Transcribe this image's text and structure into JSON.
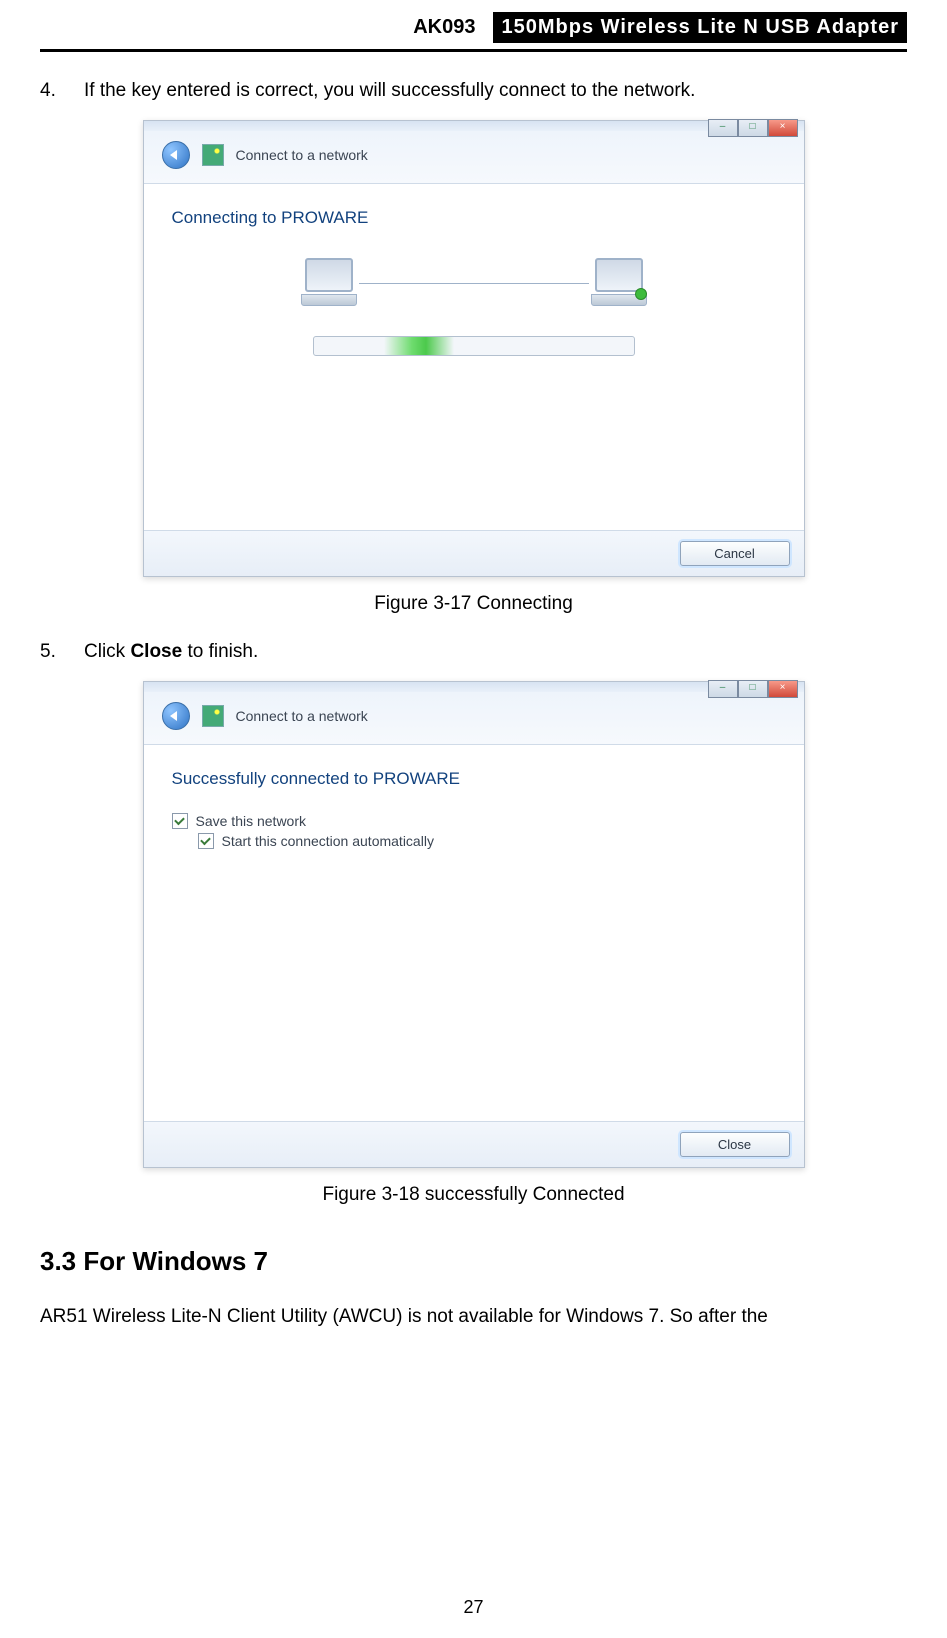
{
  "header": {
    "model": "AK093",
    "product": "150Mbps Wireless Lite N USB Adapter"
  },
  "steps": {
    "s4_num": "4.",
    "s4_text": "If the key entered is correct, you will successfully connect to the network.",
    "s5_num": "5.",
    "s5_pre": "Click ",
    "s5_bold": "Close",
    "s5_post": " to finish."
  },
  "dialog1": {
    "toolbar": "Connect to a network",
    "title": "Connecting to PROWARE",
    "cancel": "Cancel"
  },
  "dialog2": {
    "toolbar": "Connect to a network",
    "title": "Successfully connected to PROWARE",
    "chk1": "Save this network",
    "chk2": "Start this connection automatically",
    "close": "Close"
  },
  "captions": {
    "c1": "Figure 3-17 Connecting",
    "c2": "Figure 3-18 successfully Connected"
  },
  "section": {
    "heading": "3.3    For Windows 7",
    "para": "AR51 Wireless Lite-N Client Utility (AWCU) is not available for Windows 7. So after the"
  },
  "page_number": "27"
}
